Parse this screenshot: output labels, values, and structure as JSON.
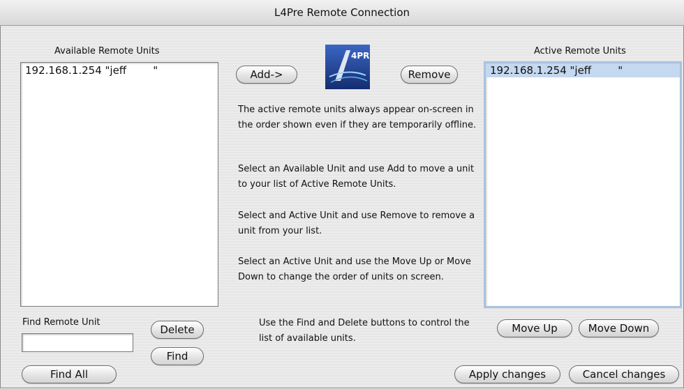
{
  "window": {
    "title": "L4Pre Remote Connection"
  },
  "logo": {
    "text": "4PRE"
  },
  "available": {
    "heading": "Available Remote Units",
    "items": [
      "192.168.1.254 \"jeff        \""
    ]
  },
  "active": {
    "heading": "Active Remote Units",
    "items": [
      "192.168.1.254 \"jeff        \""
    ]
  },
  "buttons": {
    "add": "Add->",
    "remove": "Remove",
    "delete": "Delete",
    "find": "Find",
    "find_all": "Find All",
    "move_up": "Move Up",
    "move_down": "Move Down",
    "apply": "Apply changes",
    "cancel": "Cancel changes"
  },
  "find": {
    "label": "Find Remote Unit",
    "value": ""
  },
  "help": {
    "p1": "The active remote units always appear on-screen in the order shown even if they are temporarily offline.",
    "p2": "Select an Available Unit and use Add to move a unit to your list of Active Remote Units.",
    "p3": "Select and Active Unit and use Remove to remove a unit from your list.",
    "p4": "Select an Active Unit and use the Move Up or Move Down to change the order of units on screen.",
    "p5": "Use the Find and Delete buttons to control the list of available units."
  },
  "colors": {
    "selection": "#c4d8ef",
    "focus_ring": "#a8c2e0",
    "logo_blue": "#1c3f8f"
  }
}
